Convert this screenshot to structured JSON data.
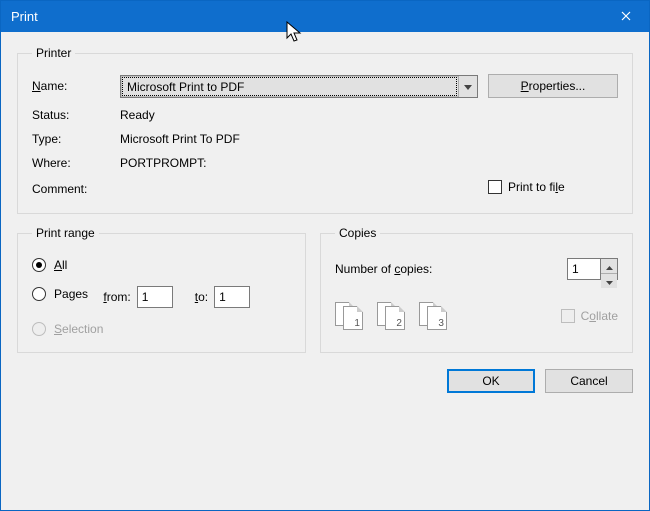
{
  "window": {
    "title": "Print"
  },
  "printer": {
    "legend": "Printer",
    "name_label": "Name:",
    "name_value": "Microsoft Print to PDF",
    "properties_label": "Properties...",
    "status_label": "Status:",
    "status_value": "Ready",
    "type_label": "Type:",
    "type_value": "Microsoft Print To PDF",
    "where_label": "Where:",
    "where_value": "PORTPROMPT:",
    "comment_label": "Comment:",
    "comment_value": "",
    "print_to_file_label": "Print to file"
  },
  "printrange": {
    "legend": "Print range",
    "all_label": "All",
    "pages_label": "Pages",
    "from_label": "from:",
    "from_value": "1",
    "to_label": "to:",
    "to_value": "1",
    "selection_label": "Selection"
  },
  "copies": {
    "legend": "Copies",
    "num_label": "Number of copies:",
    "num_value": "1",
    "collate_label": "Collate",
    "pages": [
      "1",
      "1",
      "2",
      "2",
      "3",
      "3"
    ]
  },
  "buttons": {
    "ok": "OK",
    "cancel": "Cancel"
  }
}
